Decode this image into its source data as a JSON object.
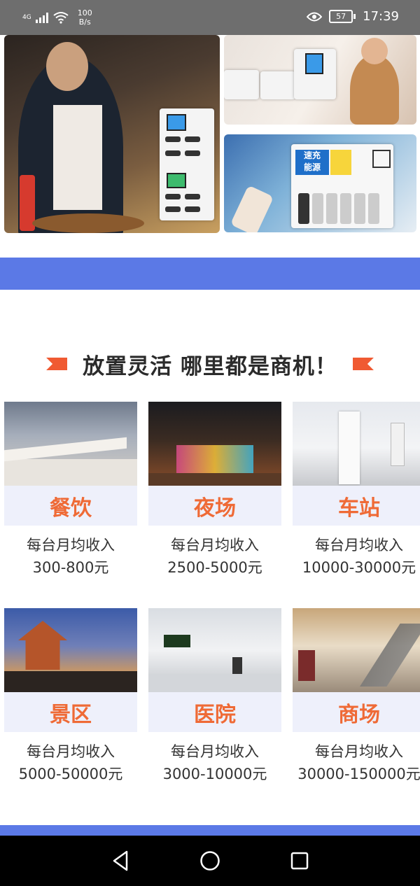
{
  "status_bar": {
    "network": "4G",
    "speed_value": "100",
    "speed_unit": "B/s",
    "battery": "57",
    "time": "17:39"
  },
  "section": {
    "title": "放置灵活 哪里都是商机！"
  },
  "photo_card": {
    "kiosk_label_line1": "速充",
    "kiosk_label_line2": "能源"
  },
  "scenarios": [
    {
      "name": "餐饮",
      "caption": "每台月均收入",
      "range": "300-800元"
    },
    {
      "name": "夜场",
      "caption": "每台月均收入",
      "range": "2500-5000元"
    },
    {
      "name": "车站",
      "caption": "每台月均收入",
      "range": "10000-30000元"
    },
    {
      "name": "景区",
      "caption": "每台月均收入",
      "range": "5000-50000元"
    },
    {
      "name": "医院",
      "caption": "每台月均收入",
      "range": "3000-10000元"
    },
    {
      "name": "商场",
      "caption": "每台月均收入",
      "range": "30000-150000元"
    }
  ],
  "colors": {
    "accent_orange": "#ef6a36",
    "page_blue": "#5b79e6",
    "label_bg": "#eef0fb"
  },
  "nav": {
    "back_icon": "triangle-back-icon",
    "home_icon": "circle-home-icon",
    "recents_icon": "square-recents-icon"
  }
}
